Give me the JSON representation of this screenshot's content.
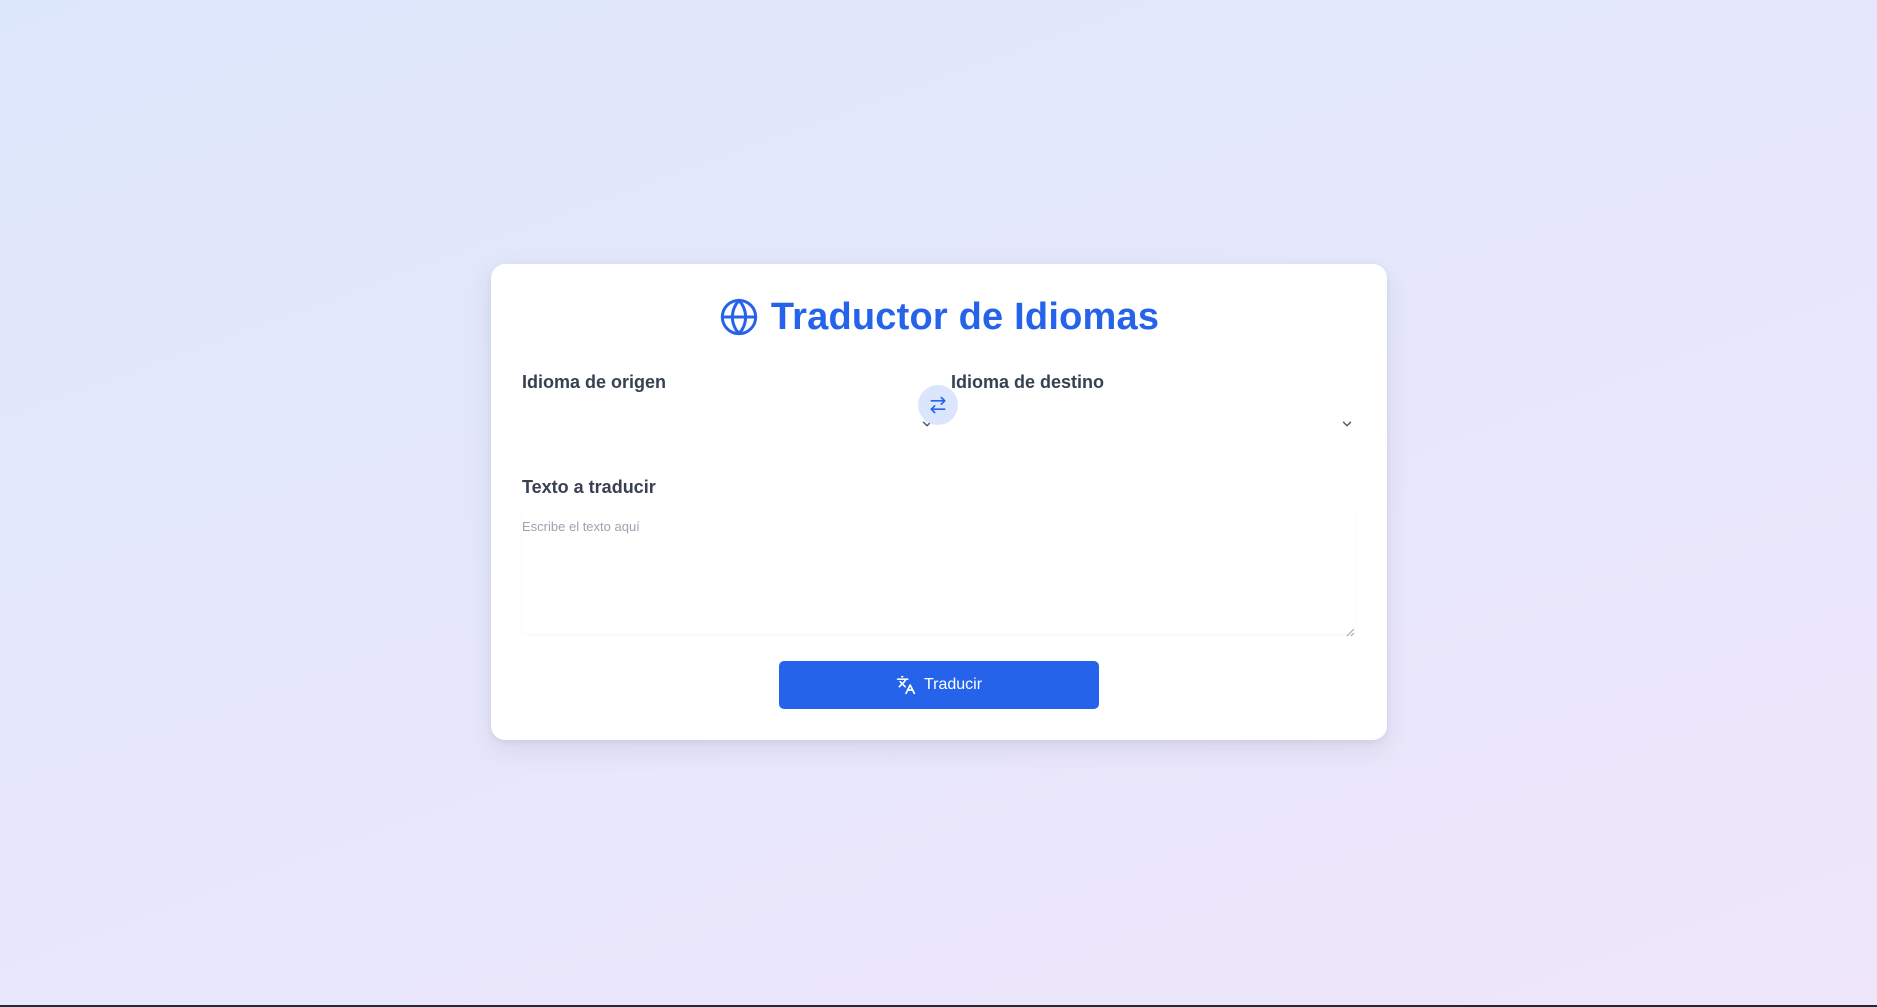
{
  "app": {
    "title": "Traductor de Idiomas",
    "title_icon": "globe-icon"
  },
  "source_language": {
    "label": "Idioma de origen",
    "selected": ""
  },
  "target_language": {
    "label": "Idioma de destino",
    "selected": ""
  },
  "swap_button": {
    "icon": "swap-arrows-icon"
  },
  "text_input": {
    "label": "Texto a traducir",
    "placeholder": "Escribe el texto aquí",
    "value": ""
  },
  "translate_button": {
    "label": "Traducir",
    "icon": "translate-icon"
  },
  "colors": {
    "accent": "#2563eb",
    "swap_bg": "#dbe6fe",
    "label_text": "#374151",
    "placeholder": "#9ca3af",
    "background_start": "#dde7fb",
    "background_end": "#efe6fb"
  }
}
